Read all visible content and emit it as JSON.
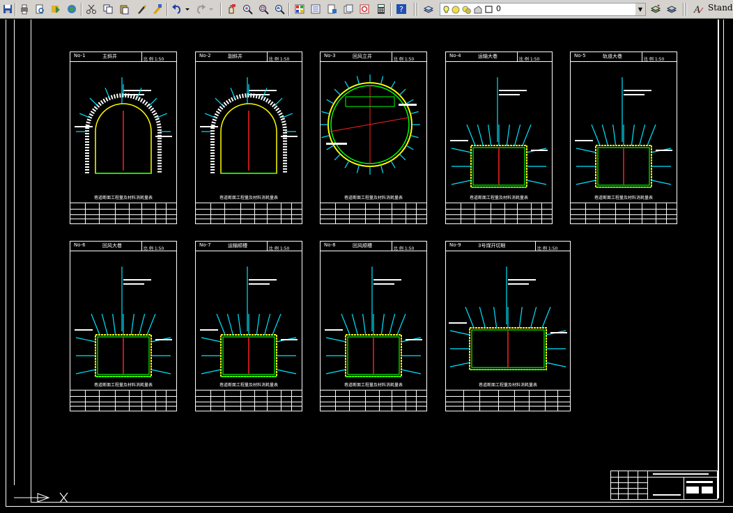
{
  "toolbar": {
    "layer_value": "0",
    "text_style": "Standa"
  },
  "sheets": [
    {
      "no": "No-1",
      "name": "主斜井",
      "scale": "比 例 1:50",
      "caption": "巷道断面工程量及材料消耗量表"
    },
    {
      "no": "No-2",
      "name": "副斜井",
      "scale": "比 例 1:50",
      "caption": "巷道断面工程量及材料消耗量表"
    },
    {
      "no": "No-3",
      "name": "回风立井",
      "scale": "比 例 1:50",
      "caption": "巷道断面工程量及材料消耗量表"
    },
    {
      "no": "No-4",
      "name": "运输大巷",
      "scale": "比 例 1:50",
      "caption": "巷道断面工程量及材料消耗量表"
    },
    {
      "no": "No-5",
      "name": "轨道大巷",
      "scale": "比 例 1:50",
      "caption": "巷道断面工程量及材料消耗量表"
    },
    {
      "no": "No-6",
      "name": "回风大巷",
      "scale": "比 例 1:50",
      "caption": "巷道断面工程量及材料消耗量表"
    },
    {
      "no": "No-7",
      "name": "运输顺槽",
      "scale": "比 例 1:50",
      "caption": "巷道断面工程量及材料消耗量表"
    },
    {
      "no": "No-8",
      "name": "回风顺槽",
      "scale": "比 例 1:50",
      "caption": "巷道断面工程量及材料消耗量表"
    },
    {
      "no": "No-9",
      "name": "3号煤开切眼",
      "scale": "比 例 1:50",
      "caption": "巷道断面工程量及材料消耗量表"
    }
  ],
  "colors": {
    "background": "#000000",
    "frame": "#ffffff",
    "bolt": "#00e5ff",
    "lining": "#ffff00",
    "section": "#00ff00",
    "center": "#ff2020"
  }
}
